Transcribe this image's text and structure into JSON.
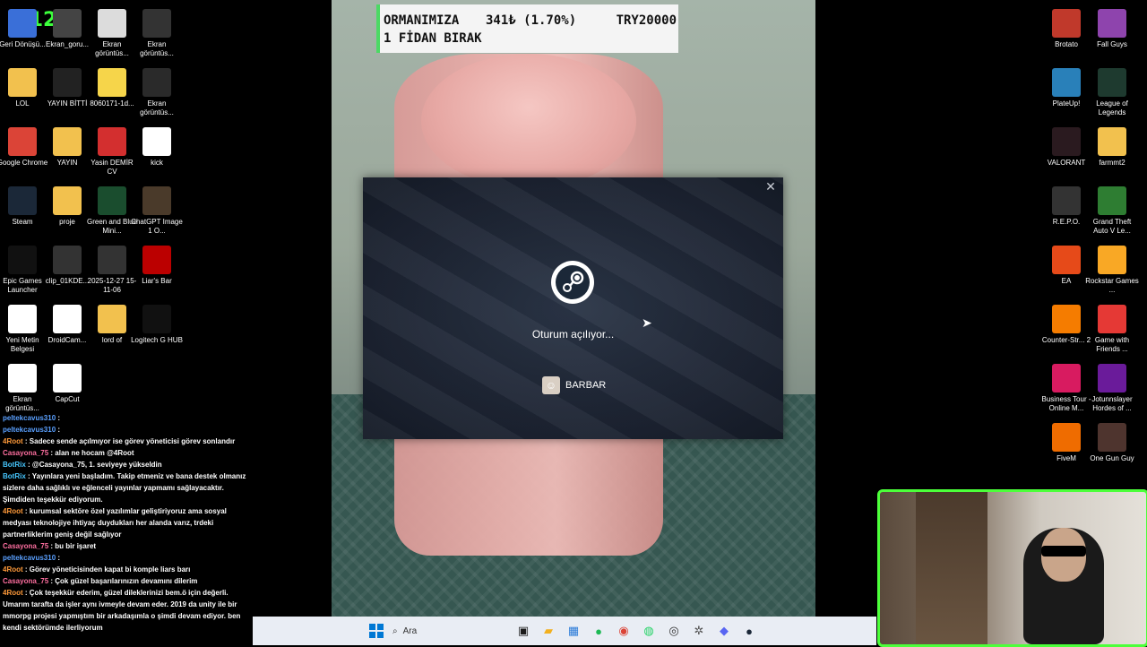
{
  "overlay": {
    "logo": "K 123",
    "banner": {
      "line1": "ORMANIMIZA",
      "amount": "341₺ (1.70%)",
      "goal": "TRY20000",
      "line2": "1 FİDAN BIRAK"
    }
  },
  "desktop_left": [
    {
      "label": "Geri Dönüşü...",
      "icon": "recycle-bin-icon",
      "color": "#3a6fd8"
    },
    {
      "label": "Ekran_goru...",
      "icon": "screenshot-icon",
      "color": "#444"
    },
    {
      "label": "Ekran görüntüs...",
      "icon": "screenshot-icon",
      "color": "#dcdcdc"
    },
    {
      "label": "Ekran görüntüs...",
      "icon": "screenshot-icon",
      "color": "#333"
    },
    {
      "label": "LOL",
      "icon": "folder-icon",
      "color": "#f2c14e"
    },
    {
      "label": "YAYIN BİTTİ",
      "icon": "video-icon",
      "color": "#222"
    },
    {
      "label": "8060171-1d...",
      "icon": "image-icon",
      "color": "#f6d54a"
    },
    {
      "label": "Ekran görüntüs...",
      "icon": "screenshot-icon",
      "color": "#2a2a2a"
    },
    {
      "label": "Google Chrome",
      "icon": "chrome-icon",
      "color": "#db4437"
    },
    {
      "label": "YAYIN",
      "icon": "folder-icon",
      "color": "#f2c14e"
    },
    {
      "label": "Yasin DEMİR CV",
      "icon": "pdf-icon",
      "color": "#d32f2f"
    },
    {
      "label": "kick",
      "icon": "image-icon",
      "color": "#fff"
    },
    {
      "label": "Steam",
      "icon": "steam-icon",
      "color": "#1b2838"
    },
    {
      "label": "proje",
      "icon": "folder-icon",
      "color": "#f2c14e"
    },
    {
      "label": "Green and Blue Mini...",
      "icon": "image-icon",
      "color": "#1a4d2e"
    },
    {
      "label": "ChatGPT Image 1 O...",
      "icon": "image-icon",
      "color": "#4a3a2a"
    },
    {
      "label": "Epic Games Launcher",
      "icon": "epic-icon",
      "color": "#111"
    },
    {
      "label": "clip_01KDE...",
      "icon": "video-icon",
      "color": "#333"
    },
    {
      "label": "2025-12-27 15-11-06",
      "icon": "video-icon",
      "color": "#333"
    },
    {
      "label": "Liar's Bar",
      "icon": "game-icon",
      "color": "#b00"
    },
    {
      "label": "Yeni Metin Belgesi",
      "icon": "text-file-icon",
      "color": "#fff"
    },
    {
      "label": "DroidCam...",
      "icon": "droidcam-icon",
      "color": "#fff"
    },
    {
      "label": "lord of",
      "icon": "folder-icon",
      "color": "#f2c14e"
    },
    {
      "label": "Logitech G HUB",
      "icon": "logitech-icon",
      "color": "#111"
    },
    {
      "label": "Ekran görüntüs...",
      "icon": "screenshot-icon",
      "color": "#fff"
    },
    {
      "label": "CapCut",
      "icon": "capcut-icon",
      "color": "#fff"
    }
  ],
  "desktop_right": [
    {
      "label": "Brotato",
      "icon": "brotato-icon",
      "color": "#c0392b"
    },
    {
      "label": "Fall Guys",
      "icon": "fallguys-icon",
      "color": "#8e44ad"
    },
    {
      "label": "PlateUp!",
      "icon": "plateup-icon",
      "color": "#2980b9"
    },
    {
      "label": "League of Legends",
      "icon": "lol-icon",
      "color": "#1e3a2f"
    },
    {
      "label": "VALORANT",
      "icon": "valorant-icon",
      "color": "#2a1a1f"
    },
    {
      "label": "farmmt2",
      "icon": "folder-icon",
      "color": "#f2c14e"
    },
    {
      "label": "R.E.P.O.",
      "icon": "repo-icon",
      "color": "#333"
    },
    {
      "label": "Grand Theft Auto V Le...",
      "icon": "gta-icon",
      "color": "#2e7d32"
    },
    {
      "label": "EA",
      "icon": "ea-icon",
      "color": "#e64a19"
    },
    {
      "label": "Rockstar Games ...",
      "icon": "rockstar-icon",
      "color": "#f9a825"
    },
    {
      "label": "Counter-Str... 2",
      "icon": "cs2-icon",
      "color": "#f57c00"
    },
    {
      "label": "Game with Friends ...",
      "icon": "game-icon",
      "color": "#e53935"
    },
    {
      "label": "Business Tour - Online M...",
      "icon": "business-tour-icon",
      "color": "#d81b60"
    },
    {
      "label": "Jotunnslayer Hordes of ...",
      "icon": "jotunnslayer-icon",
      "color": "#6a1b9a"
    },
    {
      "label": "FiveM",
      "icon": "fivem-icon",
      "color": "#ef6c00"
    },
    {
      "label": "One Gun Guy",
      "icon": "onegunguy-icon",
      "color": "#4e342e"
    }
  ],
  "steam_dialog": {
    "status": "Oturum açılıyor...",
    "username": "BARBAR",
    "close": "✕"
  },
  "chat": [
    {
      "user": "peltekcavus310",
      "text": " :",
      "color": "u-blue"
    },
    {
      "user": "peltekcavus310",
      "text": " :",
      "color": "u-blue"
    },
    {
      "user": "4Root",
      "text": " : Sadece sende açılmıyor ise görev yöneticisi görev sonlandır",
      "color": "u-orange"
    },
    {
      "user": "Casayona_75",
      "text": " : alan ne hocam @4Root",
      "color": "u-pink"
    },
    {
      "user": "BotRix",
      "text": " : @Casayona_75, 1. seviyeye yükseldin",
      "color": "u-cyan"
    },
    {
      "user": "BotRix",
      "text": " : Yayınlara yeni başladım. Takip etmeniz ve bana destek olmanız sizlere daha sağlıklı ve eğlenceli yayınlar yapmamı sağlayacaktır. Şimdiden teşekkür ediyorum.",
      "color": "u-cyan"
    },
    {
      "user": "4Root",
      "text": " : kurumsal sektöre özel yazılımlar geliştiriyoruz ama sosyal medyası teknolojiye ihtiyaç duydukları her alanda varız, trdeki partnerliklerim geniş değil sağlıyor",
      "color": "u-orange"
    },
    {
      "user": "Casayona_75",
      "text": " : bu bir işaret",
      "color": "u-pink"
    },
    {
      "user": "peltekcavus310",
      "text": " :",
      "color": "u-blue"
    },
    {
      "user": "4Root",
      "text": " : Görev yöneticisinden kapat bi komple liars barı",
      "color": "u-orange"
    },
    {
      "user": "Casayona_75",
      "text": " : Çok güzel başarılarınızın devamını dilerim",
      "color": "u-pink"
    },
    {
      "user": "4Root",
      "text": " : Çok teşekkür ederim, güzel dileklerinizi bem.ö için değerli. Umarım tarafta da işler aynı ivmeyle devam eder. 2019 da unity ile bir mmorpg projesi yapmıştım bir arkadaşımla o şimdi devam ediyor. ben kendi sektörümde ilerliyorum",
      "color": "u-orange"
    }
  ],
  "taskbar": {
    "search_placeholder": "Ara",
    "items": [
      "start-icon",
      "search-icon",
      "task-view-icon",
      "file-explorer-icon",
      "store-icon",
      "spotify-icon",
      "chrome-icon",
      "whatsapp-icon",
      "obs-icon",
      "settings-icon",
      "discord-icon",
      "steam-icon"
    ]
  }
}
